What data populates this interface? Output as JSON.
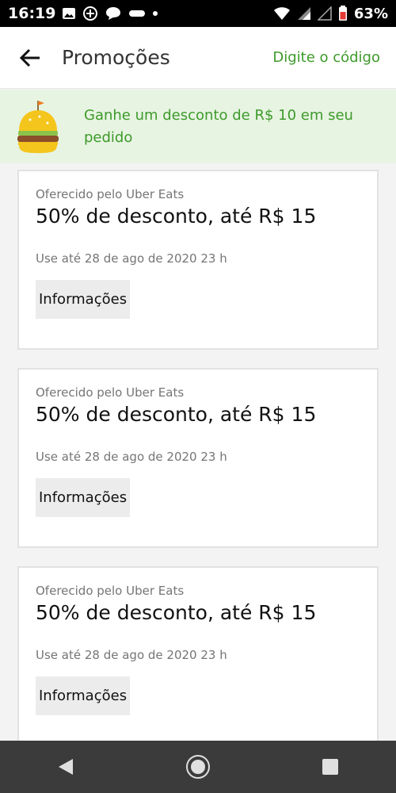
{
  "status_bar": {
    "time": "16:19",
    "battery": "63%"
  },
  "app_bar": {
    "title": "Promoções",
    "code_link": "Digite o código"
  },
  "banner": {
    "text": "Ganhe um desconto de R$ 10 em seu pedido"
  },
  "offers": [
    {
      "offered_by": "Oferecido pelo Uber Eats",
      "title": "50% de desconto, até R$ 15",
      "valid_until": "Use até 28 de ago de 2020 23 h",
      "info_label": "Informações"
    },
    {
      "offered_by": "Oferecido pelo Uber Eats",
      "title": "50% de desconto, até R$ 15",
      "valid_until": "Use até 28 de ago de 2020 23 h",
      "info_label": "Informações"
    },
    {
      "offered_by": "Oferecido pelo Uber Eats",
      "title": "50% de desconto, até R$ 15",
      "valid_until": "Use até 28 de ago de 2020 23 h",
      "info_label": "Informações"
    }
  ],
  "colors": {
    "accent_green": "#3e9a2b",
    "banner_bg": "#e7f4e2",
    "nav_bar": "#3b3b3b"
  },
  "icons": {
    "back": "arrow-left-icon",
    "banner": "burger-icon",
    "nav_back": "triangle-back-icon",
    "nav_home": "circle-home-icon",
    "nav_recent": "square-recents-icon"
  }
}
